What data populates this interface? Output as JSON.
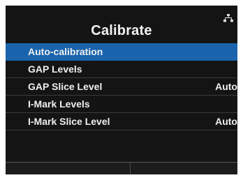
{
  "header": {
    "title": "Calibrate",
    "status_icon": "network-icon"
  },
  "menu": {
    "items": [
      {
        "label": "Auto-calibration",
        "value": "",
        "selected": true
      },
      {
        "label": "GAP Levels",
        "value": ""
      },
      {
        "label": "GAP Slice Level",
        "value": "Auto"
      },
      {
        "label": "I-Mark Levels",
        "value": ""
      },
      {
        "label": "I-Mark Slice Level",
        "value": "Auto"
      }
    ]
  },
  "colors": {
    "background": "#141414",
    "selected_row": "#1a64ad",
    "text": "#efefef"
  }
}
